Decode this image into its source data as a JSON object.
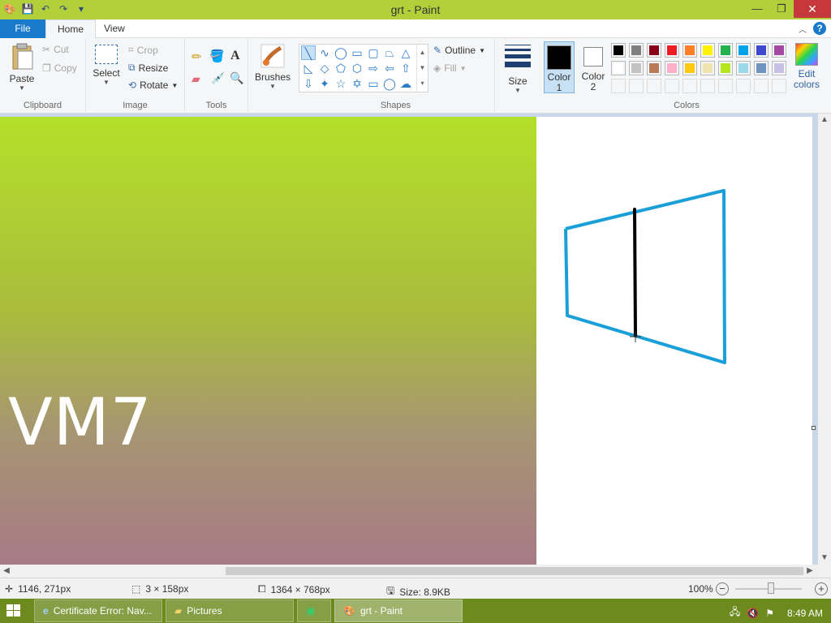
{
  "window": {
    "title": "grt - Paint"
  },
  "quick_access": [
    "paint-app-icon",
    "save-icon",
    "undo-icon",
    "redo-icon",
    "customize-icon"
  ],
  "tabs": {
    "file": "File",
    "home": "Home",
    "view": "View"
  },
  "ribbon": {
    "clipboard": {
      "label": "Clipboard",
      "paste": "Paste",
      "cut": "Cut",
      "copy": "Copy"
    },
    "image": {
      "label": "Image",
      "select": "Select",
      "crop": "Crop",
      "resize": "Resize",
      "rotate": "Rotate"
    },
    "tools": {
      "label": "Tools"
    },
    "brushes": {
      "label": "Brushes"
    },
    "shapes": {
      "label": "Shapes",
      "outline": "Outline",
      "fill": "Fill"
    },
    "size": {
      "label": "Size"
    },
    "colors": {
      "label": "Colors",
      "color1": [
        "Color",
        "1"
      ],
      "color2": [
        "Color",
        "2"
      ],
      "color1_value": "#000000",
      "color2_value": "#ffffff",
      "edit": [
        "Edit",
        "colors"
      ],
      "palette_row1": [
        "#000000",
        "#7f7f7f",
        "#880015",
        "#ed1c24",
        "#ff7f27",
        "#fff200",
        "#22b14c",
        "#00a2e8",
        "#3f48cc",
        "#a349a4"
      ],
      "palette_row2": [
        "#ffffff",
        "#c3c3c3",
        "#b97a57",
        "#ffaec9",
        "#ffc90e",
        "#efe4b0",
        "#b5e61d",
        "#99d9ea",
        "#7092be",
        "#c8bfe7"
      ]
    }
  },
  "canvas": {
    "image_text": "VM7",
    "stroke_color": "#1a9fd8"
  },
  "status": {
    "cursor_pos": "1146, 271px",
    "selection_size": "3 × 158px",
    "image_size": "1364 × 768px",
    "file_size": "Size: 8.9KB",
    "zoom": "100%"
  },
  "taskbar": {
    "items": [
      {
        "label": "Certificate Error: Nav..."
      },
      {
        "label": "Pictures"
      },
      {
        "label": ""
      },
      {
        "label": "grt - Paint"
      }
    ],
    "clock": "8:49 AM"
  }
}
